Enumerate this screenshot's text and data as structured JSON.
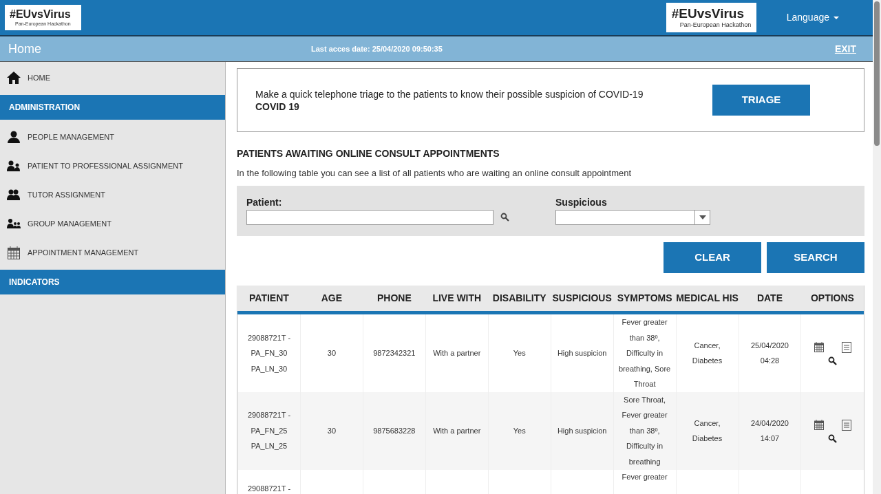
{
  "header": {
    "logo_left": {
      "title": "#EUvsVirus",
      "subtitle": "Pan-European Hackathon"
    },
    "logo_right": {
      "title": "#EUvsVirus",
      "subtitle": "Pan-European Hackathon"
    },
    "language": "Language"
  },
  "subheader": {
    "title": "Home",
    "last_access": "Last acces date: 25/04/2020 09:50:35",
    "exit": "EXIT"
  },
  "sidebar": {
    "items": [
      {
        "kind": "item",
        "label": "HOME"
      },
      {
        "kind": "section",
        "label": "ADMINISTRATION"
      },
      {
        "kind": "item",
        "label": "PEOPLE MANAGEMENT"
      },
      {
        "kind": "item",
        "label": "PATIENT TO PROFESSIONAL ASSIGNMENT"
      },
      {
        "kind": "item",
        "label": "TUTOR ASSIGNMENT"
      },
      {
        "kind": "item",
        "label": "GROUP MANAGEMENT"
      },
      {
        "kind": "item",
        "label": "APPOINTMENT MANAGEMENT"
      },
      {
        "kind": "section",
        "label": "INDICATORS"
      }
    ]
  },
  "triage": {
    "text": "Make a quick telephone triage to the patients to know their possible suspicion of COVID-19",
    "highlight": "COVID 19",
    "button": "TRIAGE"
  },
  "section": {
    "title": "PATIENTS AWAITING ONLINE CONSULT APPOINTMENTS",
    "description": "In the following table you can see a list of all patients who are waiting an online consult appointment"
  },
  "filters": {
    "patient_label": "Patient:",
    "suspicious_label": "Suspicious",
    "buttons": [
      "CLEAR",
      "SEARCH"
    ]
  },
  "table": {
    "columns": [
      "PATIENT",
      "AGE",
      "PHONE",
      "LIVE WITH",
      "DISABILITY",
      "SUSPICIOUS",
      "SYMPTOMS",
      "MEDICAL HIS",
      "DATE",
      "OPTIONS"
    ],
    "rows": [
      {
        "cells": [
          "29088721T - PA_FN_30 PA_LN_30",
          "30",
          "9872342321",
          "With a partner",
          "Yes",
          "High suspicion",
          "Fever greater than 38º, Difficulty in breathing, Sore Throat",
          "Cancer, Diabetes",
          "25/04/2020 04:28"
        ],
        "options": true
      },
      {
        "cells": [
          "29088721T - PA_FN_25 PA_LN_25",
          "30",
          "9875683228",
          "With a partner",
          "Yes",
          "High suspicion",
          "Sore Throat, Fever greater than 38º, Difficulty in breathing",
          "Cancer, Diabetes",
          "24/04/2020 14:07"
        ],
        "options": true
      },
      {
        "cells": [
          "29088721T -",
          "",
          "",
          "",
          "",
          "",
          "Fever greater",
          "",
          ""
        ],
        "options": false
      }
    ]
  }
}
